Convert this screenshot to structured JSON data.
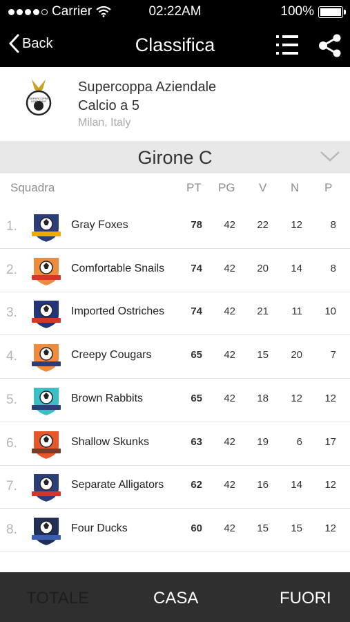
{
  "status": {
    "carrier": "Carrier",
    "time": "02:22AM",
    "battery": "100%",
    "battery_level": 1.0
  },
  "nav": {
    "back_label": "Back",
    "title": "Classifica",
    "list_icon": "list-icon",
    "share_icon": "share-icon"
  },
  "league": {
    "name": "Supercoppa Aziendale",
    "subtitle": "Calcio a 5",
    "location": "Milan, Italy",
    "logo_text": [
      "SUPERCOPPA",
      "AZIENDALE"
    ]
  },
  "group": {
    "name": "Girone C"
  },
  "table": {
    "headers": {
      "team": "Squadra",
      "pt": "PT",
      "pg": "PG",
      "v": "V",
      "n": "N",
      "p": "P"
    },
    "rows": [
      {
        "rank": "1.",
        "team": "Gray Foxes",
        "pt": "78",
        "pg": "42",
        "v": "22",
        "n": "12",
        "p": "8",
        "crest_color": "#2c3e7a",
        "crest_accent": "#f2a900"
      },
      {
        "rank": "2.",
        "team": "Comfortable Snails",
        "pt": "74",
        "pg": "42",
        "v": "20",
        "n": "14",
        "p": "8",
        "crest_color": "#f08a3c",
        "crest_accent": "#d6352b"
      },
      {
        "rank": "3.",
        "team": "Imported Ostriches",
        "pt": "74",
        "pg": "42",
        "v": "21",
        "n": "11",
        "p": "10",
        "crest_color": "#23357a",
        "crest_accent": "#d6352b"
      },
      {
        "rank": "4.",
        "team": "Creepy Cougars",
        "pt": "65",
        "pg": "42",
        "v": "15",
        "n": "20",
        "p": "7",
        "crest_color": "#f08a3c",
        "crest_accent": "#2c3e7a"
      },
      {
        "rank": "5.",
        "team": "Brown Rabbits",
        "pt": "65",
        "pg": "42",
        "v": "18",
        "n": "12",
        "p": "12",
        "crest_color": "#3bbfc6",
        "crest_accent": "#2c3e7a"
      },
      {
        "rank": "6.",
        "team": "Shallow Skunks",
        "pt": "63",
        "pg": "42",
        "v": "19",
        "n": "6",
        "p": "17",
        "crest_color": "#e8572a",
        "crest_accent": "#7a3a2a"
      },
      {
        "rank": "7.",
        "team": "Separate Alligators",
        "pt": "62",
        "pg": "42",
        "v": "16",
        "n": "14",
        "p": "12",
        "crest_color": "#2c3e7a",
        "crest_accent": "#d6352b"
      },
      {
        "rank": "8.",
        "team": "Four Ducks",
        "pt": "60",
        "pg": "42",
        "v": "15",
        "n": "15",
        "p": "12",
        "crest_color": "#1f2f5a",
        "crest_accent": "#3b5fb0"
      }
    ]
  },
  "tabs": [
    {
      "label": "TOTALE",
      "selected": true
    },
    {
      "label": "CASA",
      "selected": false
    },
    {
      "label": "FUORI",
      "selected": false
    }
  ],
  "colors": {
    "nav_bg": "#000000",
    "group_bg": "#e8e8e8",
    "tabbar_bg": "#2f2f2f",
    "tab_selected": "#1e1e1e"
  }
}
